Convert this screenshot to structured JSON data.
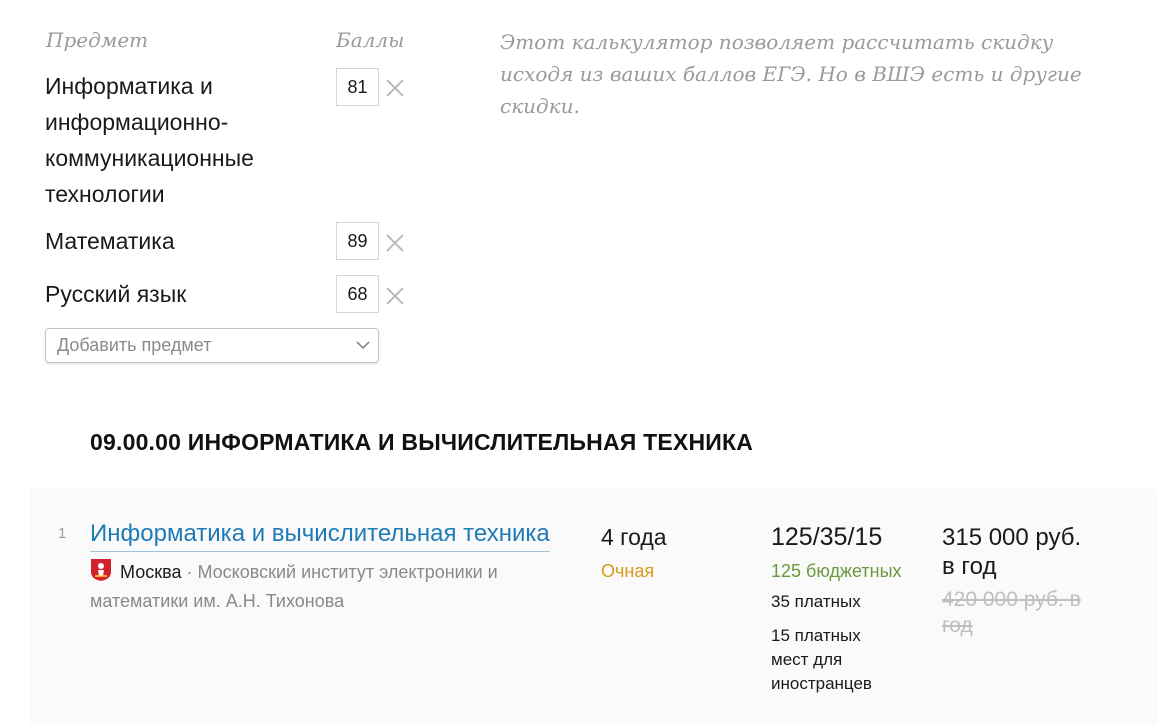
{
  "calculator": {
    "subject_header": "Предмет",
    "score_header": "Баллы",
    "subjects": [
      {
        "name": "Информатика и информационно-коммуникационные технологии",
        "score": "81"
      },
      {
        "name": "Математика",
        "score": "89"
      },
      {
        "name": "Русский язык",
        "score": "68"
      }
    ],
    "add_subject_placeholder": "Добавить предмет",
    "note": "Этот калькулятор позволяет рассчитать скидку исходя из ваших баллов ЕГЭ. Но в ВШЭ есть и другие скидки."
  },
  "section": {
    "title": "09.00.00 ИНФОРМАТИКА И ВЫЧИСЛИТЕЛЬНАЯ ТЕХНИКА"
  },
  "program": {
    "number": "1",
    "name": "Информатика и вычислительная техника",
    "city": "Москва",
    "institute": "· Московский институт электроники и математики им. А.Н. Тихонова",
    "duration": "4 года",
    "mode": "Очная",
    "places": "125/35/15",
    "budget": "125 бюджетных",
    "paid": "35 платных",
    "foreign": "15 платных мест для иностранцев",
    "price": "315 000 руб. в год",
    "old_price": "420 000 руб. в год"
  },
  "colors": {
    "link": "#1f7ab8",
    "mode": "#d79a1a",
    "budget": "#6a9a3c",
    "muted": "#9a9a9a"
  },
  "icons": {
    "remove": "close-icon",
    "select": "chevron-down-icon",
    "city": "moscow-coat-of-arms-icon"
  }
}
